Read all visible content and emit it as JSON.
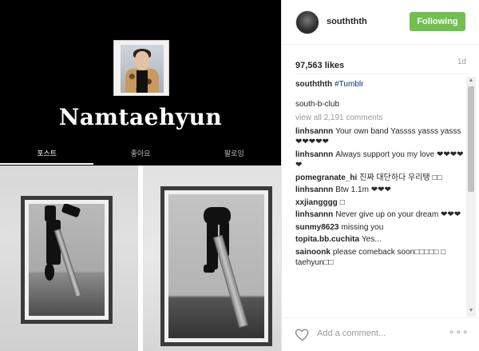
{
  "profile": {
    "name": "Namtaehyun",
    "tabs": [
      "포스트",
      "좋아요",
      "팔로잉"
    ]
  },
  "post": {
    "username": "souththth",
    "follow_label": "Following",
    "likes": "97,563 likes",
    "age": "1d",
    "caption": {
      "user": "souththth",
      "tag": "#Tumblr"
    },
    "caption_extra": "south-b-club",
    "view_all": "view all 2,191 comments",
    "comments": [
      {
        "user": "linhsannn",
        "text": "Your own band Yassss yasss yasss ❤❤❤❤❤"
      },
      {
        "user": "linhsannn",
        "text": "Always support you my love ❤❤❤❤❤"
      },
      {
        "user": "pomegranate_hi",
        "text": "진짜 대단하다 우리탱 □□"
      },
      {
        "user": "linhsannn",
        "text": "Btw 1.1m ❤❤❤"
      },
      {
        "user": "xxjiangggg",
        "text": "□"
      },
      {
        "user": "linhsannn",
        "text": "Never give up on your dream ❤❤❤"
      },
      {
        "user": "sunmy8623",
        "text": "missing you"
      },
      {
        "user": "topita.bb.cuchita",
        "text": "Yes..."
      },
      {
        "user": "sainoonk",
        "text": "please comeback soon□□□□□ □ taehyun□□"
      }
    ],
    "add_comment_placeholder": "Add a comment...",
    "more_label": "∘∘∘"
  },
  "icons": {
    "heart": "heart-outline-icon",
    "scroll_up": "▲",
    "scroll_down": "▼"
  },
  "colors": {
    "follow_button": "#70c050",
    "tag_link": "#003569"
  }
}
